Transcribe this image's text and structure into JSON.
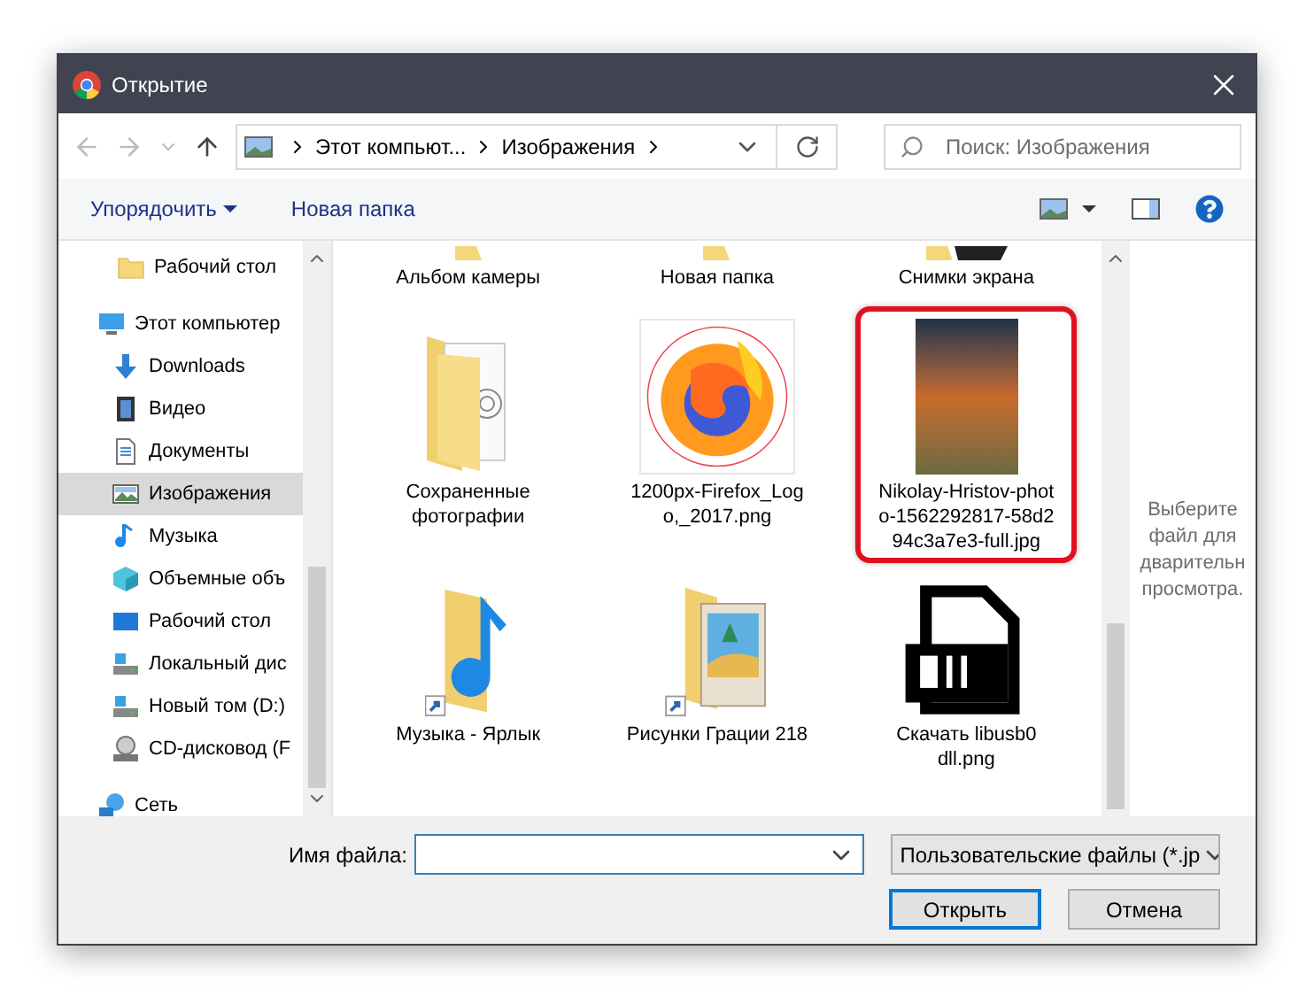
{
  "window": {
    "title": "Открытие"
  },
  "address": {
    "crumbs": [
      "Этот компьют...",
      "Изображения"
    ]
  },
  "search": {
    "placeholder": "Поиск: Изображения"
  },
  "toolbar": {
    "organize": "Упорядочить",
    "new_folder": "Новая папка"
  },
  "sidebar": {
    "items": [
      {
        "label": "Рабочий стол",
        "kind": "folder",
        "selected": false
      },
      {
        "label": "Этот компьютер",
        "kind": "computer",
        "selected": false,
        "children": [
          {
            "label": "Downloads",
            "kind": "download",
            "selected": false
          },
          {
            "label": "Видео",
            "kind": "video",
            "selected": false
          },
          {
            "label": "Документы",
            "kind": "document",
            "selected": false
          },
          {
            "label": "Изображения",
            "kind": "pictures",
            "selected": true
          },
          {
            "label": "Музыка",
            "kind": "music",
            "selected": false
          },
          {
            "label": "Объемные объ",
            "kind": "objects",
            "selected": false
          },
          {
            "label": "Рабочий стол",
            "kind": "desktop",
            "selected": false
          },
          {
            "label": "Локальный дис",
            "kind": "drive",
            "selected": false
          },
          {
            "label": "Новый том (D:)",
            "kind": "drive",
            "selected": false
          },
          {
            "label": "CD-дисковод (F",
            "kind": "cd",
            "selected": false
          }
        ]
      },
      {
        "label": "Сеть",
        "kind": "network",
        "selected": false
      }
    ]
  },
  "files": [
    {
      "name": "Альбом камеры",
      "kind": "folder-top",
      "highlighted": false
    },
    {
      "name": "Новая папка",
      "kind": "folder-top",
      "highlighted": false
    },
    {
      "name": "Снимки экрана",
      "kind": "screens-top",
      "highlighted": false
    },
    {
      "name": "Сохраненные фотографии",
      "kind": "folder-photos",
      "highlighted": false
    },
    {
      "name": "1200px-Firefox_Logo,_2017.png",
      "kind": "firefox-image",
      "highlighted": false
    },
    {
      "name": "Nikolay-Hristov-photo-1562292817-58d294c3a7e3-full.jpg",
      "kind": "photo",
      "highlighted": true
    },
    {
      "name": "Музыка - Ярлык",
      "kind": "music-shortcut",
      "highlighted": false
    },
    {
      "name": "Рисунки Грации 218",
      "kind": "pictures-shortcut",
      "highlighted": false
    },
    {
      "name": "Скачать libusb0 dll.png",
      "kind": "dll-image",
      "highlighted": false
    }
  ],
  "preview": {
    "lines": [
      "Выберите",
      "файл для",
      "дварительн",
      "просмотра."
    ]
  },
  "filename": {
    "label": "Имя файла:"
  },
  "filter": {
    "value": "Пользовательские файлы (*.jp"
  },
  "buttons": [
    {
      "label": "Открыть",
      "kind": "default"
    },
    {
      "label": "Отмена",
      "kind": "normal"
    }
  ]
}
